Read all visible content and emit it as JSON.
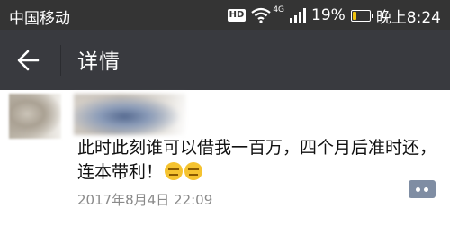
{
  "status_bar": {
    "carrier": "中国移动",
    "hd_badge": "HD",
    "network": "4G",
    "battery": "19%",
    "battery_level": 0.19,
    "battery_color": "#f1c40f",
    "time": "晚上8:24"
  },
  "title_bar": {
    "back_icon": "arrow-left-icon",
    "title": "详情",
    "background": "#393a3f"
  },
  "post": {
    "text": "此时此刻谁可以借我一百万，四个月后准时还，连本带利！",
    "emojis": [
      "expressionless-face",
      "expressionless-face"
    ],
    "timestamp": "2017年8月4日 22:09",
    "comment_icon": "comment-dots-icon",
    "comment_button_color": "#7f8da3"
  }
}
